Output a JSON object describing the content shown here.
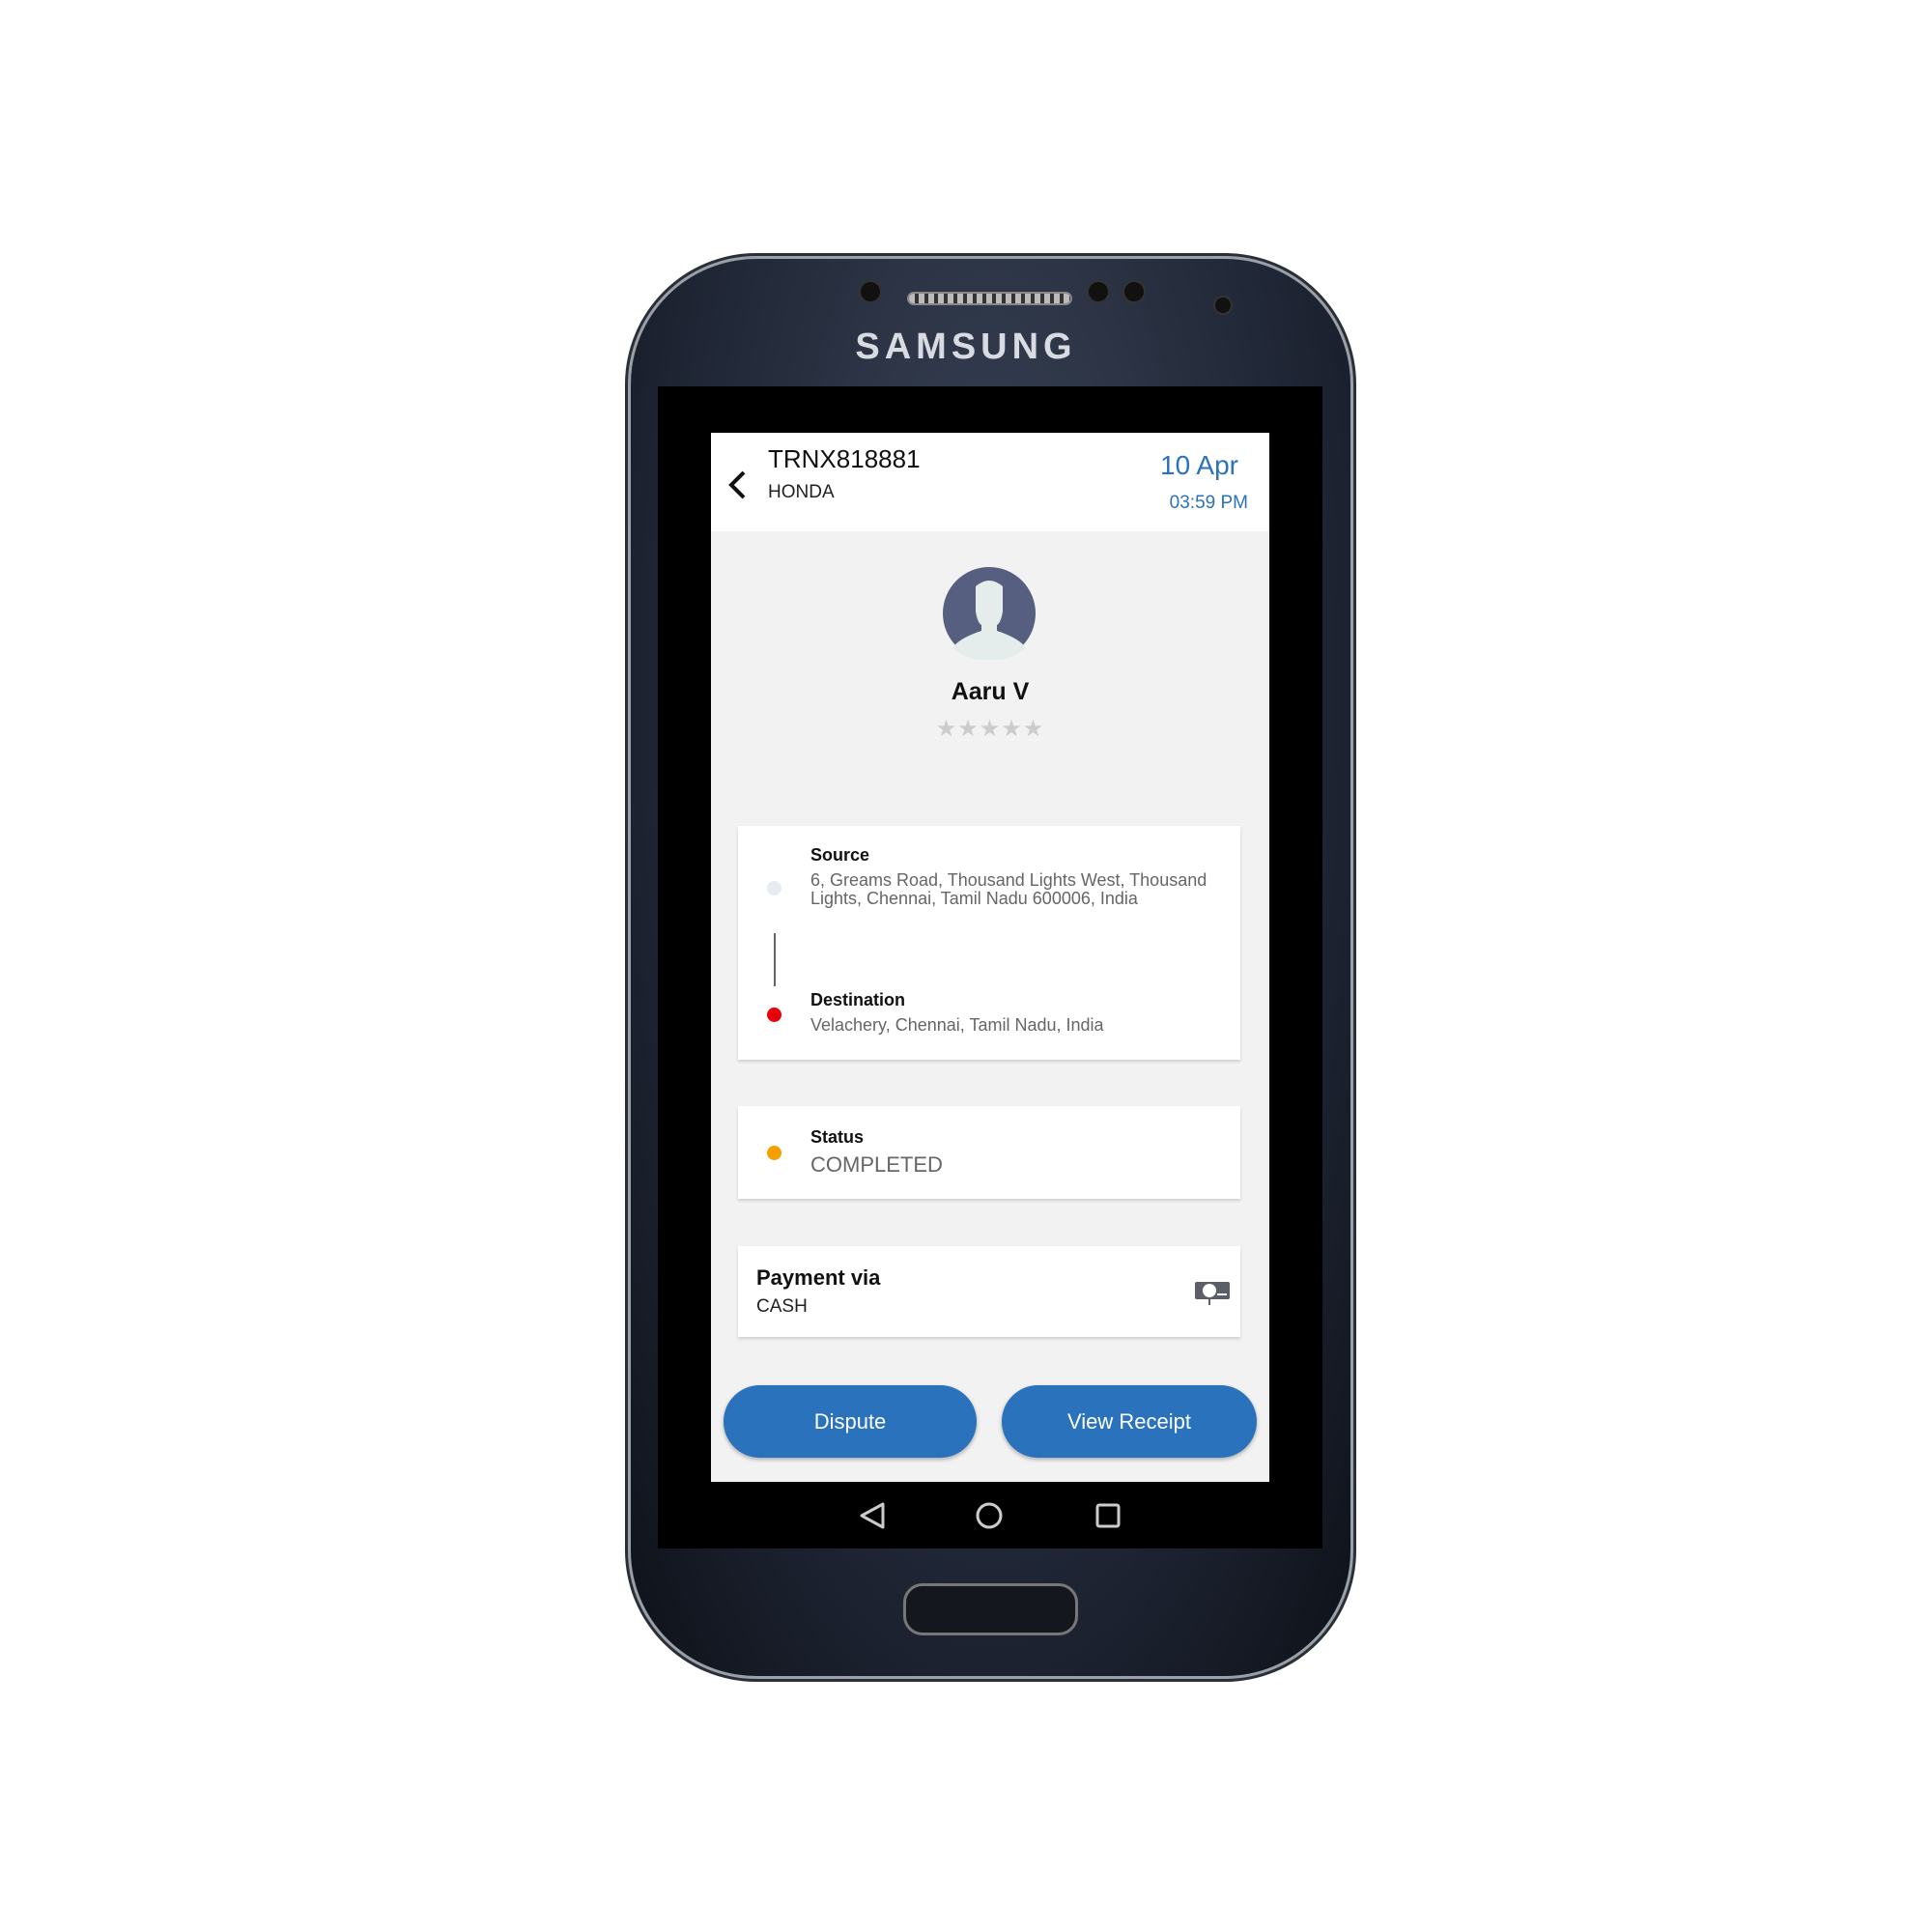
{
  "device": {
    "brand": "SAMSUNG"
  },
  "header": {
    "transaction_id": "TRNX818881",
    "vehicle": "HONDA",
    "date": "10 Apr",
    "time": "03:59 PM",
    "back_icon": "chevron-left-icon"
  },
  "profile": {
    "name": "Aaru V",
    "rating": 0,
    "rating_max": 5,
    "avatar_icon": "person-silhouette-icon"
  },
  "trip": {
    "source_label": "Source",
    "source_address": "6, Greams Road, Thousand Lights West, Thousand Lights, Chennai, Tamil Nadu 600006, India",
    "destination_label": "Destination",
    "destination_address": "Velachery, Chennai, Tamil Nadu, India"
  },
  "status": {
    "label": "Status",
    "value": "COMPLETED",
    "color": "#f5a000"
  },
  "payment": {
    "label": "Payment via",
    "method": "CASH",
    "icon": "cash-icon"
  },
  "actions": {
    "dispute": "Dispute",
    "view_receipt": "View Receipt"
  },
  "colors": {
    "accent": "#2a72bc",
    "destination": "#e8000b"
  }
}
